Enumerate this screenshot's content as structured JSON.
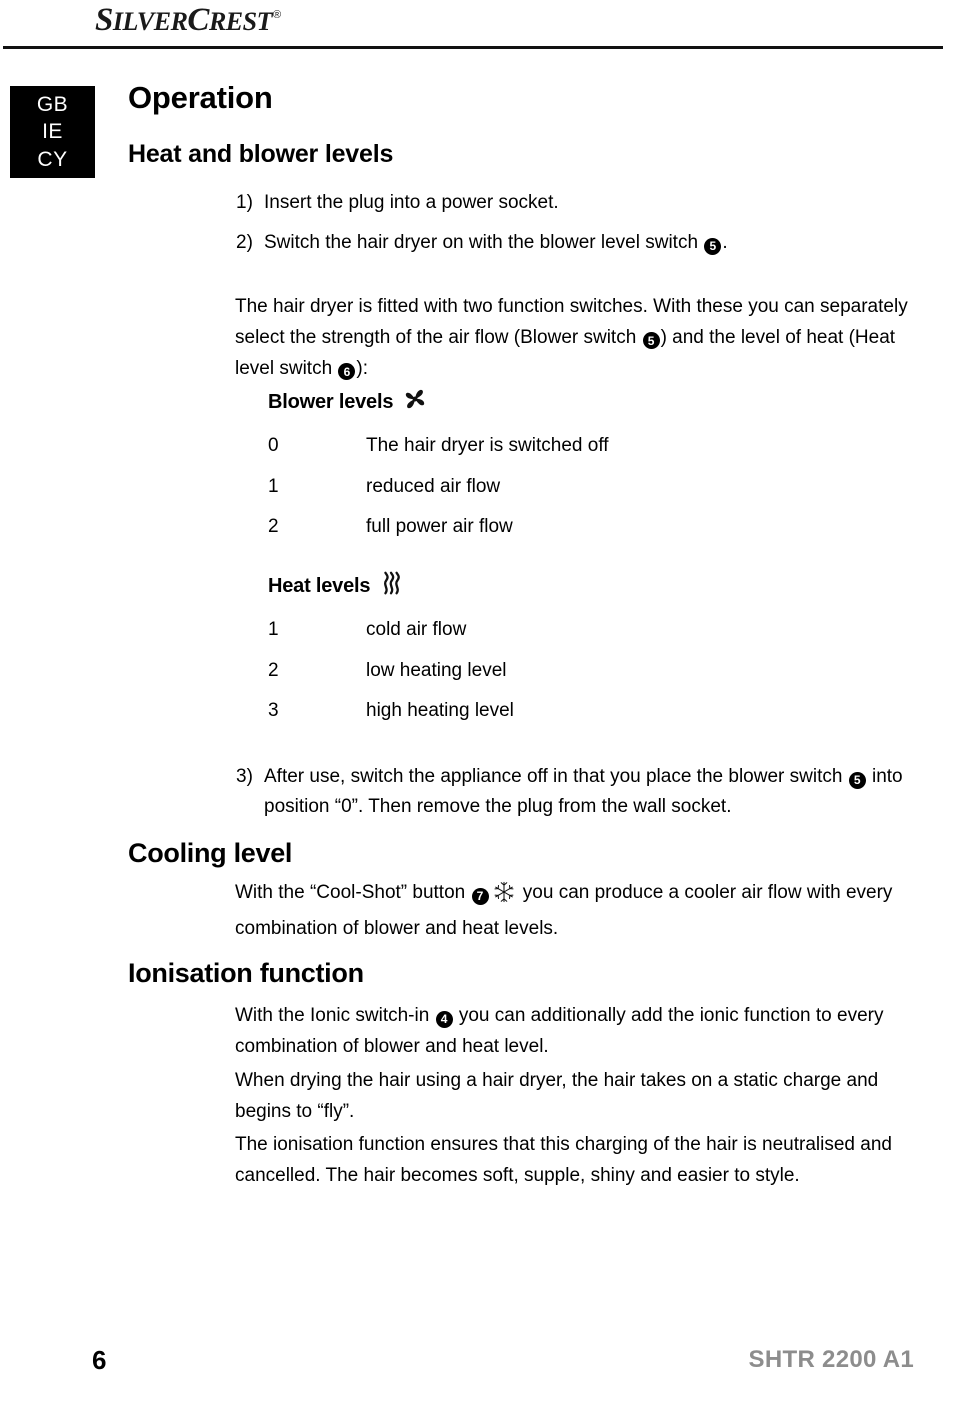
{
  "header": {
    "brand_first": "S",
    "brand_first_rest": "ILVER",
    "brand_second": "C",
    "brand_second_rest": "REST",
    "brand_registered": "®",
    "brand_full": "SILVERCREST®"
  },
  "country_box": {
    "codes": [
      "GB",
      "IE",
      "CY"
    ]
  },
  "section": {
    "title": "Operation",
    "subtitle": "Heat and blower levels"
  },
  "steps": [
    {
      "num": "1)",
      "text_before": "Insert the plug into a power socket.",
      "marker": null,
      "text_after": ""
    },
    {
      "num": "2)",
      "text_before": "Switch the hair dryer on with the blower level switch ",
      "marker": "5",
      "text_after": "."
    }
  ],
  "intro": {
    "part1": "The hair dryer is fitted with two function switches. With these you can separately select the strength of the air flow (Blower switch ",
    "marker1": "5",
    "part2": ") and the level of heat (Heat level switch ",
    "marker2": "6",
    "part3": "):"
  },
  "blower": {
    "heading": "Blower levels",
    "icon": "fan-icon",
    "rows": [
      {
        "level": "0",
        "desc": "The hair dryer is switched off"
      },
      {
        "level": "1",
        "desc": "reduced air flow"
      },
      {
        "level": "2",
        "desc": "full power air flow"
      }
    ]
  },
  "heat": {
    "heading": "Heat levels",
    "icon": "heat-waves-icon",
    "rows": [
      {
        "level": "1",
        "desc": "cold air flow"
      },
      {
        "level": "2",
        "desc": "low heating level"
      },
      {
        "level": "3",
        "desc": "high heating level"
      }
    ]
  },
  "step3": {
    "num": "3)",
    "part1": "After use, switch the appliance off in that you place the blower switch ",
    "marker": "5",
    "part2": " into position “0”. Then remove the plug from the wall socket."
  },
  "cooling": {
    "heading": "Cooling level",
    "part1": "With the “Cool-Shot” button ",
    "marker": "7",
    "icon": "snowflake-icon",
    "part2": " you can produce a cooler air flow with every combination of blower and heat levels."
  },
  "ionisation": {
    "heading": "Ionisation function",
    "p1_part1": "With the Ionic switch-in ",
    "p1_marker": "4",
    "p1_part2": " you can additionally add the ionic function to every combination of blower and heat level.",
    "p2": "When drying the hair using a hair dryer, the hair takes on a static charge and begins to “fly”.",
    "p3": "The ionisation function ensures that this charging of the hair is neutralised and cancelled. The hair becomes soft, supple, shiny and easier to style."
  },
  "footer": {
    "page_number": "6",
    "model": "SHTR 2200 A1"
  },
  "colors": {
    "text": "#000000",
    "rule": "#111111",
    "footer_model": "#8d8d8d",
    "tab_background": "#000000",
    "tab_text": "#ffffff"
  }
}
